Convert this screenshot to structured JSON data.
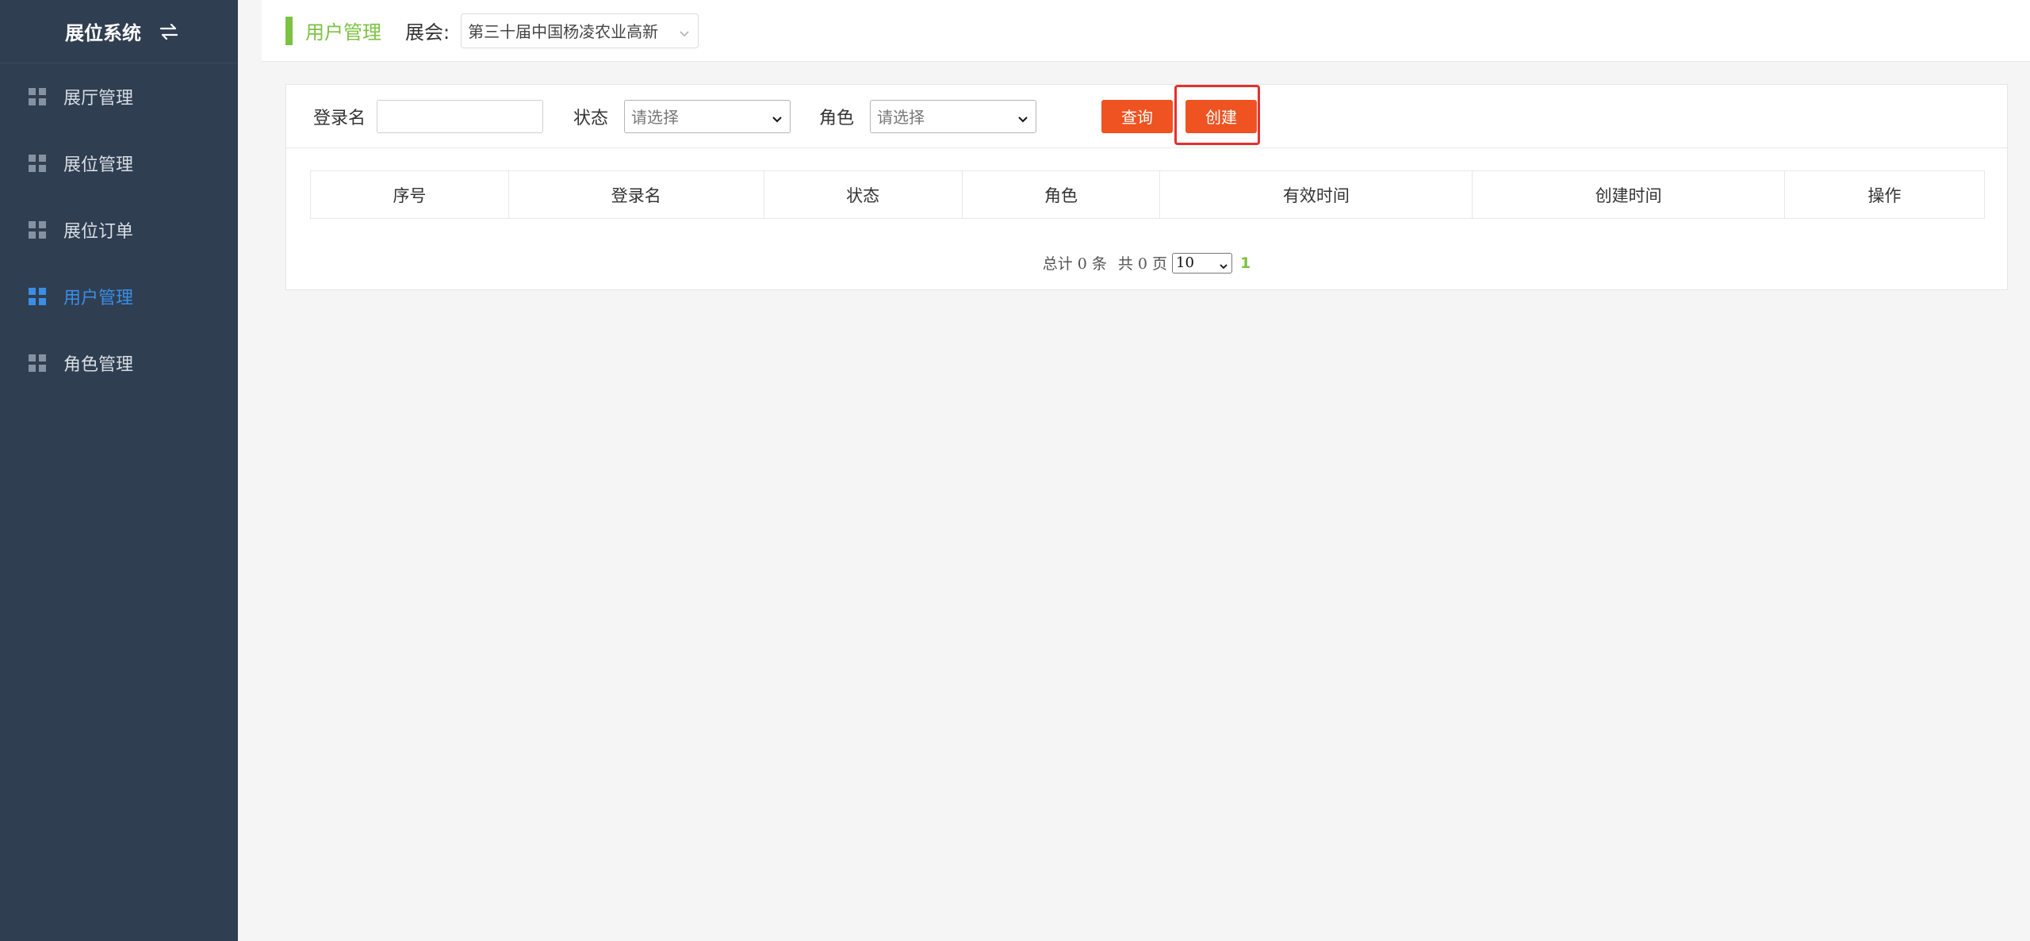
{
  "sidebar": {
    "title": "展位系统",
    "items": [
      {
        "label": "展厅管理",
        "active": false
      },
      {
        "label": "展位管理",
        "active": false
      },
      {
        "label": "展位订单",
        "active": false
      },
      {
        "label": "用户管理",
        "active": true
      },
      {
        "label": "角色管理",
        "active": false
      }
    ],
    "icons": {
      "toggle": "swap-icon",
      "item": "grid-icon"
    }
  },
  "header": {
    "page_title": "用户管理",
    "expo_label": "展会:",
    "expo_value": "第三十届中国杨凌农业高新"
  },
  "filters": {
    "login_label": "登录名",
    "login_value": "",
    "status_label": "状态",
    "status_placeholder": "请选择",
    "role_label": "角色",
    "role_placeholder": "请选择",
    "query_button": "查询",
    "create_button": "创建"
  },
  "table": {
    "columns": [
      "序号",
      "登录名",
      "状态",
      "角色",
      "有效时间",
      "创建时间",
      "操作"
    ],
    "rows": []
  },
  "pagination": {
    "total_text": "总计 0 条",
    "pages_text": "共 0 页",
    "page_size": "10",
    "current_page": "1"
  },
  "colors": {
    "sidebar_bg": "#2f3e51",
    "accent_green": "#7cc242",
    "active_blue": "#3a8ee6",
    "button_orange": "#ee5321",
    "highlight_red": "#e52f2f"
  }
}
